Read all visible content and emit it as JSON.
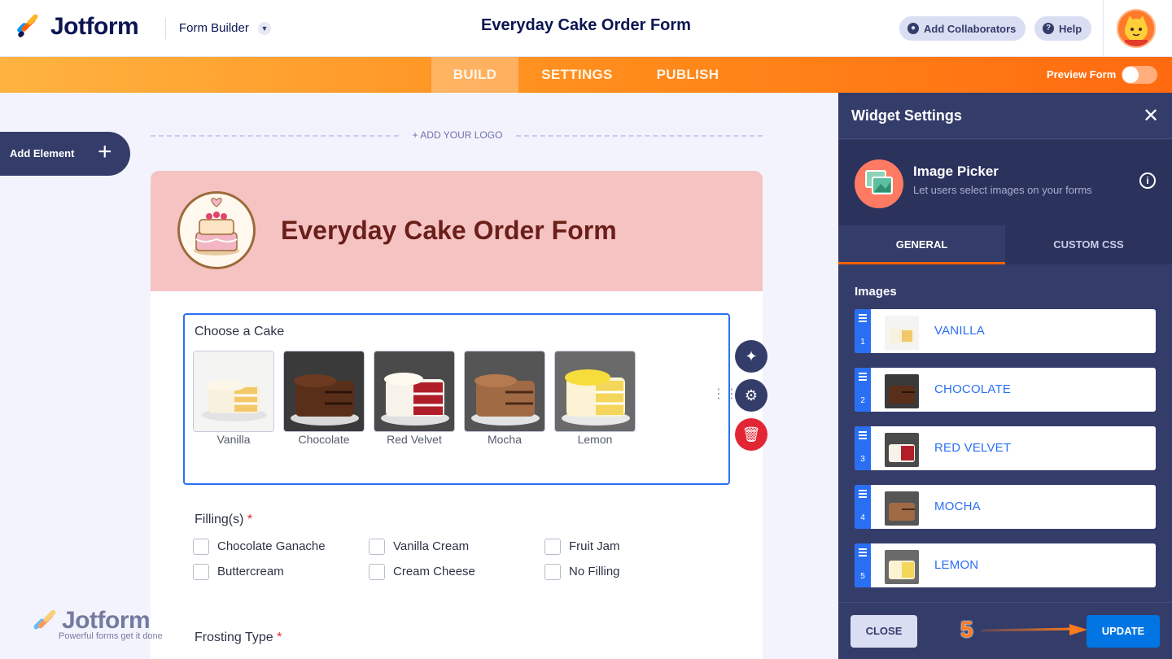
{
  "app": {
    "brand": "Jotform",
    "mode_label": "Form Builder",
    "form_title": "Everyday Cake Order Form",
    "add_collaborators": "Add Collaborators",
    "help": "Help"
  },
  "nav": {
    "tabs": [
      "BUILD",
      "SETTINGS",
      "PUBLISH"
    ],
    "active_tab": "BUILD",
    "preview_label": "Preview Form",
    "preview_on": false
  },
  "builder": {
    "add_element": "Add Element",
    "add_logo": "+ ADD YOUR LOGO"
  },
  "form": {
    "heading": "Everyday Cake Order Form",
    "cake_question": "Choose a Cake",
    "cake_options": [
      "Vanilla",
      "Chocolate",
      "Red Velvet",
      "Mocha",
      "Lemon"
    ],
    "filling_question": "Filling(s)",
    "required_mark": "*",
    "fillings": [
      "Chocolate Ganache",
      "Vanilla Cream",
      "Fruit Jam",
      "Buttercream",
      "Cream Cheese",
      "No Filling"
    ],
    "frosting_question": "Frosting Type"
  },
  "watermark": {
    "word": "Jotform",
    "tagline": "Powerful forms get it done"
  },
  "panel": {
    "title": "Widget Settings",
    "widget_name": "Image Picker",
    "widget_desc": "Let users select images on your forms",
    "tabs": [
      "GENERAL",
      "CUSTOM CSS"
    ],
    "active_tab": "GENERAL",
    "images_label": "Images",
    "images": [
      {
        "num": "1",
        "name": "VANILLA"
      },
      {
        "num": "2",
        "name": "CHOCOLATE"
      },
      {
        "num": "3",
        "name": "RED VELVET"
      },
      {
        "num": "4",
        "name": "MOCHA"
      },
      {
        "num": "5",
        "name": "LEMON"
      }
    ],
    "close_btn": "CLOSE",
    "update_btn": "UPDATE"
  },
  "annotation": {
    "step": "5",
    "color": "#ff7a1a"
  },
  "colors": {
    "accent_orange": "#ff6100",
    "primary_blue": "#2a6ff3",
    "panel_navy": "#343c6a",
    "header_pink": "#f6c3c3"
  }
}
